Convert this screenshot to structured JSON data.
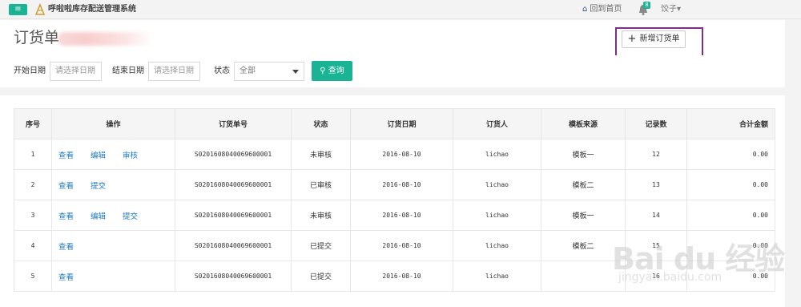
{
  "topbar": {
    "menu_icon": "menu-icon",
    "app_title": "呼啦啦库存配送管理系统",
    "home_label": "回到首页",
    "notification_count": "8",
    "user_name": "饺子▾"
  },
  "header": {
    "title": "订货单",
    "add_button_label": "新增订货单"
  },
  "filters": {
    "start_label": "开始日期",
    "start_placeholder": "请选择日期",
    "end_label": "结束日期",
    "end_placeholder": "请选择日期",
    "status_label": "状态",
    "status_value": "全部",
    "query_label": "查询"
  },
  "table": {
    "headers": [
      "序号",
      "操作",
      "订货单号",
      "状态",
      "订货日期",
      "订货人",
      "模板来源",
      "记录数",
      "合计金额"
    ],
    "rows": [
      {
        "no": "1",
        "ops": [
          "查看",
          "编辑",
          "审核"
        ],
        "order_no": "S0201608040069600001",
        "status": "未审核",
        "date": "2016-08-10",
        "person": "lichao",
        "template": "模板一",
        "records": "12",
        "amount": "0.00"
      },
      {
        "no": "2",
        "ops": [
          "查看",
          "提交",
          ""
        ],
        "order_no": "S0201608040069600001",
        "status": "已审核",
        "date": "2016-08-10",
        "person": "lichao",
        "template": "模板二",
        "records": "13",
        "amount": "0.00"
      },
      {
        "no": "3",
        "ops": [
          "查看",
          "编辑",
          "提交"
        ],
        "order_no": "S0201608040069600001",
        "status": "未审核",
        "date": "2016-08-10",
        "person": "lichao",
        "template": "模板一",
        "records": "14",
        "amount": "0.00"
      },
      {
        "no": "4",
        "ops": [
          "查看",
          "",
          ""
        ],
        "order_no": "S0201608040069600001",
        "status": "已提交",
        "date": "2016-08-10",
        "person": "lichao",
        "template": "模板二",
        "records": "15",
        "amount": "0.00"
      },
      {
        "no": "5",
        "ops": [
          "查看",
          "",
          ""
        ],
        "order_no": "S0201608040069600001",
        "status": "已提交",
        "date": "2016-08-10",
        "person": "lichao",
        "template": "",
        "records": "16",
        "amount": "0.00"
      }
    ]
  },
  "watermark": {
    "main": "Bai du 经验",
    "sub": "jingyan.baidu.com"
  },
  "colors": {
    "accent": "#1ab394",
    "link": "#1d7ac7",
    "highlight": "#7b2f86"
  }
}
